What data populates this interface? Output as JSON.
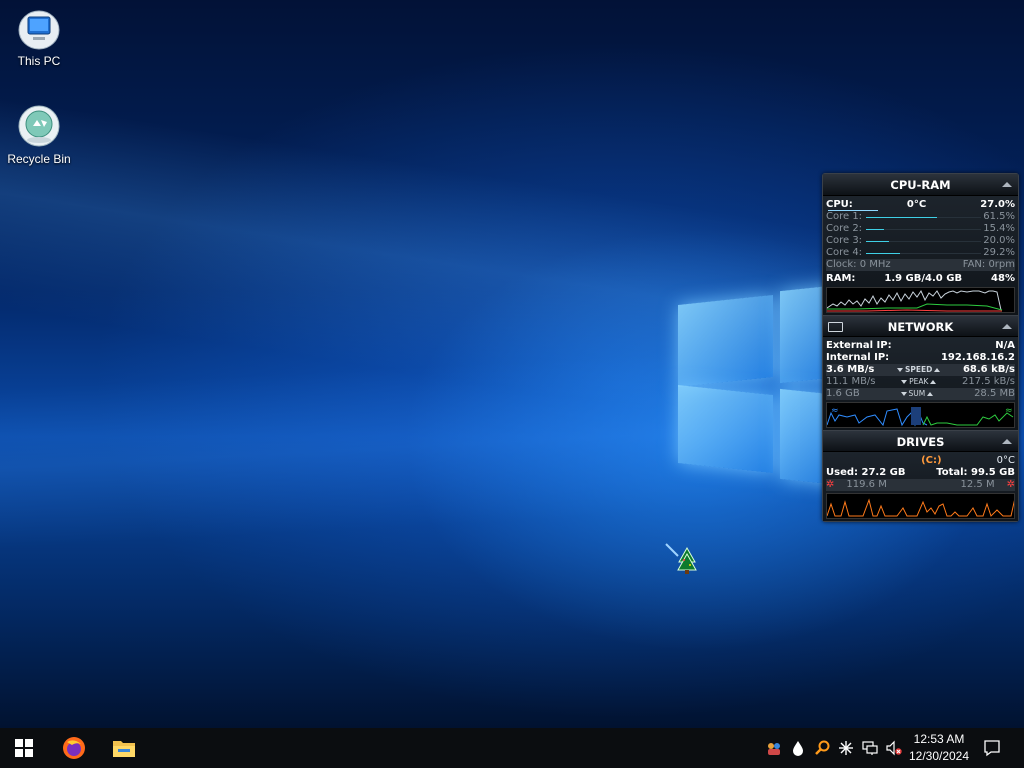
{
  "desktop": {
    "icons": [
      {
        "label": "This PC"
      },
      {
        "label": "Recycle Bin"
      }
    ]
  },
  "gadget": {
    "cpu_ram": {
      "title": "CPU-RAM",
      "cpu_label": "CPU:",
      "cpu_temp": "0°C",
      "cpu_percent": "27.0%",
      "cores": [
        {
          "label": "Core 1:",
          "value": "61.5%",
          "level": 0.615
        },
        {
          "label": "Core 2:",
          "value": "15.4%",
          "level": 0.154
        },
        {
          "label": "Core 3:",
          "value": "20.0%",
          "level": 0.2
        },
        {
          "label": "Core 4:",
          "value": "29.2%",
          "level": 0.292
        }
      ],
      "clock": "Clock: 0 MHz",
      "fan": "FAN: 0rpm",
      "ram_label": "RAM:",
      "ram_used": "1.9 GB/4.0 GB",
      "ram_percent": "48%"
    },
    "network": {
      "title": "NETWORK",
      "external_ip_label": "External IP:",
      "external_ip": "N/A",
      "internal_ip_label": "Internal IP:",
      "internal_ip": "192.168.16.2",
      "speed_down": "3.6 MB/s",
      "speed_label": "SPEED",
      "speed_up": "68.6 kB/s",
      "peak_down": "11.1 MB/s",
      "peak_label": "PEAK",
      "peak_up": "217.5 kB/s",
      "sum_down": "1.6 GB",
      "sum_label": "SUM",
      "sum_up": "28.5 MB"
    },
    "drives": {
      "title": "DRIVES",
      "drive_letter": "(C:)",
      "temp": "0°C",
      "used": "Used: 27.2 GB",
      "total": "Total: 99.5 GB",
      "read": "119.6 M",
      "write": "12.5 M"
    }
  },
  "taskbar": {
    "clock_time": "12:53 AM",
    "clock_date": "12/30/2024"
  },
  "colors": {
    "accent_cyan": "#3fd0e6",
    "drive_orange": "#ff9a3c",
    "net_green": "#2ecc40",
    "net_blue": "#2f8cff"
  }
}
